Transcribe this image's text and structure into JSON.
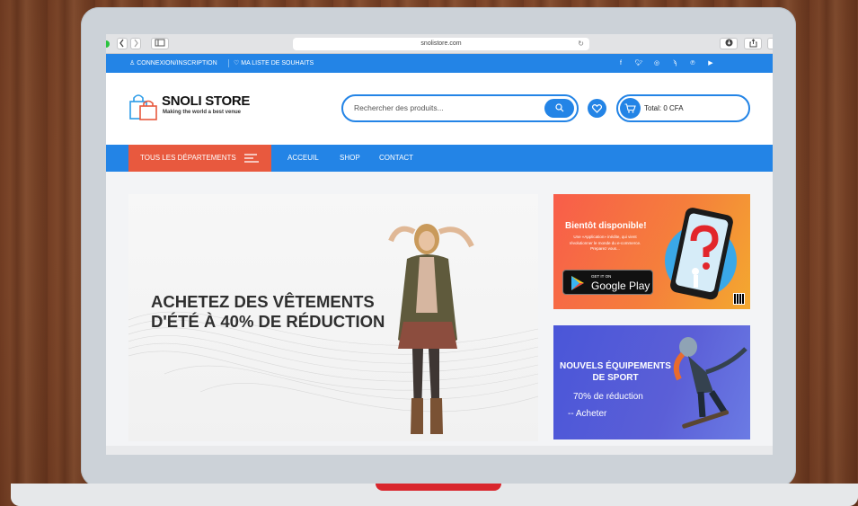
{
  "browser": {
    "url": "snolistore.com"
  },
  "topbar": {
    "login": "CONNEXION/INSCRIPTION",
    "wishlist": "MA LISTE DE SOUHAITS",
    "social_icons": [
      "facebook-icon",
      "twitter-icon",
      "instagram-icon",
      "rss-icon",
      "pinterest-icon",
      "youtube-icon"
    ]
  },
  "header": {
    "logo_title": "SNOLI STORE",
    "logo_tagline": "Making the world a best venue",
    "search_placeholder": "Rechercher des produits...",
    "cart_total": "Total: 0 CFA"
  },
  "nav": {
    "departments": "TOUS LES DÉPARTEMENTS",
    "links": [
      "ACCEUIL",
      "SHOP",
      "CONTACT"
    ]
  },
  "hero": {
    "line1": "ACHETEZ DES VÊTEMENTS",
    "line2": "D'ÉTÉ À 40% DE RÉDUCTION"
  },
  "app_banner": {
    "title": "Bientôt disponible!",
    "description": "Une «Application» inédite, qui vient révolutionner le monde du e-commerce. Preparez vous...",
    "store_get": "GET IT ON",
    "store_name": "Google Play"
  },
  "sport_banner": {
    "title_line1": "NOUVELS ÉQUIPEMENTS",
    "title_line2": "DE SPORT",
    "discount": "70% de réduction",
    "cta": "-- Acheter"
  },
  "colors": {
    "primary": "#2384e6",
    "departments_bg": "#e8593e"
  }
}
